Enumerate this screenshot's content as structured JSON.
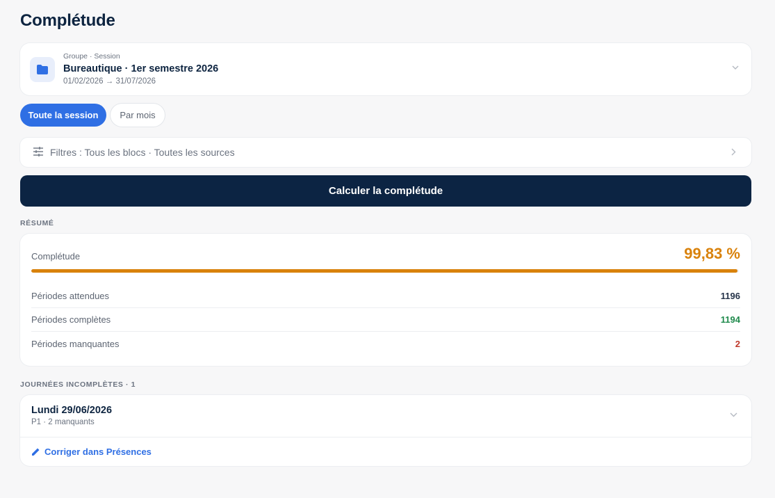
{
  "page": {
    "title": "Complétude"
  },
  "session": {
    "kicker": "Groupe · Session",
    "title": "Bureautique · 1er semestre 2026",
    "dates": "01/02/2026 → 31/07/2026",
    "icon": "folder-icon"
  },
  "tabs": [
    {
      "label": "Toute la session",
      "active": true
    },
    {
      "label": "Par mois",
      "active": false
    }
  ],
  "filters": {
    "label": "Filtres : Tous les blocs · Toutes les sources",
    "icon": "sliders-icon"
  },
  "actions": {
    "calculate_label": "Calculer la complétude"
  },
  "summary": {
    "section_title": "RÉSUMÉ",
    "completeness_label": "Complétude",
    "completeness_value": "99,83 %",
    "completeness_fraction": 0.9983,
    "accent_color": "#d9820c",
    "stats": [
      {
        "label": "Périodes attendues",
        "value": "1196",
        "color": "#26344a"
      },
      {
        "label": "Périodes complètes",
        "value": "1194",
        "color": "#1f8a4c"
      },
      {
        "label": "Périodes manquantes",
        "value": "2",
        "color": "#c0392b"
      }
    ]
  },
  "incomplete": {
    "section_title": "JOURNÉES INCOMPLÈTES · 1",
    "days": [
      {
        "date": "Lundi 29/06/2026",
        "detail": "P1 · 2 manquants"
      }
    ],
    "fix_label": "Corriger dans Présences",
    "fix_icon": "pencil-icon"
  }
}
